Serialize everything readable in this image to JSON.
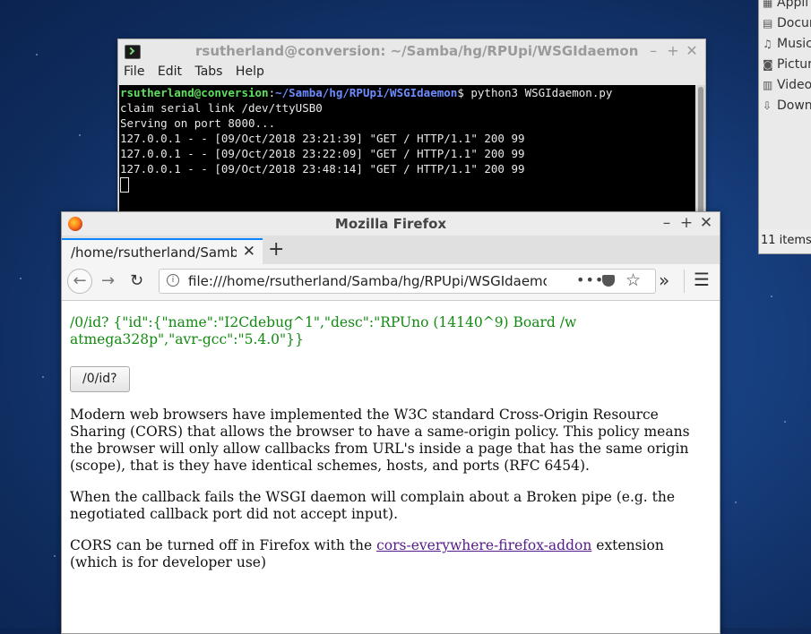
{
  "file_manager": {
    "items": [
      {
        "label": "Appli",
        "icon": "applications-icon"
      },
      {
        "label": "Docum",
        "icon": "document-icon"
      },
      {
        "label": "Music",
        "icon": "music-icon"
      },
      {
        "label": "Pictur",
        "icon": "camera-icon"
      },
      {
        "label": "Video",
        "icon": "film-icon"
      },
      {
        "label": "Down",
        "icon": "download-icon"
      }
    ],
    "status": "11 items"
  },
  "terminal": {
    "title": "rsutherland@conversion: ~/Samba/hg/RPUpi/WSGIdaemon",
    "menu": [
      "File",
      "Edit",
      "Tabs",
      "Help"
    ],
    "prompt_user": "rsutherland@conversion",
    "prompt_path": "~/Samba/hg/RPUpi/WSGIdaemon",
    "prompt_command": "$ python3 WSGIdaemon.py",
    "lines": [
      "claim serial link /dev/ttyUSB0",
      "Serving on port 8000...",
      "127.0.0.1 - - [09/Oct/2018 23:21:39] \"GET / HTTP/1.1\" 200 99",
      "127.0.0.1 - - [09/Oct/2018 23:22:09] \"GET / HTTP/1.1\" 200 99",
      "127.0.0.1 - - [09/Oct/2018 23:48:14] \"GET / HTTP/1.1\" 200 99"
    ]
  },
  "firefox": {
    "title": "Mozilla Firefox",
    "tab_label": "/home/rsutherland/Samba/",
    "url": "file:///home/rsutherland/Samba/hg/RPUpi/WSGIdaemon/cl",
    "content": {
      "json_text": "/0/id? {\"id\":{\"name\":\"I2Cdebug^1\",\"desc\":\"RPUno (14140^9) Board /w atmega328p\",\"avr-gcc\":\"5.4.0\"}}",
      "button_label": "/0/id?",
      "para1": "Modern web browsers have implemented the W3C standard Cross-Origin Resource Sharing (CORS) that allows the browser to have a same-origin policy. This policy means the browser will only allow callbacks from URL's inside a page that has the same origin (scope), that is they have identical schemes, hosts, and ports (RFC 6454).",
      "para2": "When the callback fails the WSGI daemon will complain about a Broken pipe (e.g. the negotiated callback port did not accept input).",
      "para3_prefix": "CORS can be turned off in Firefox with the ",
      "para3_link": "cors-everywhere-firefox-addon",
      "para3_suffix": " extension (which is for developer use)"
    }
  }
}
